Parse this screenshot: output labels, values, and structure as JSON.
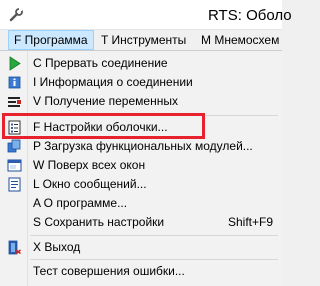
{
  "window": {
    "title": "RTS: Оболо",
    "app_icon": "wrench-icon"
  },
  "menubar": {
    "items": [
      {
        "label": "F Программа",
        "active": true
      },
      {
        "label": "T Инструменты",
        "active": false
      },
      {
        "label": "M Мнемосхем",
        "active": false
      }
    ]
  },
  "menu": {
    "items": [
      {
        "label": "C Прервать соединение",
        "icon": "play-icon"
      },
      {
        "label": "I Информация о соединении",
        "icon": "info-icon"
      },
      {
        "label": "V Получение переменных",
        "icon": "variables-icon"
      },
      {
        "label": "F Настройки оболочки...",
        "icon": "settings-sheet-icon"
      },
      {
        "label": "P Загрузка функциональных модулей...",
        "icon": "modules-icon"
      },
      {
        "label": "W Поверх всех окон",
        "icon": "window-icon"
      },
      {
        "label": "L Окно сообщений...",
        "icon": "messages-icon"
      },
      {
        "label": "A О программе...",
        "icon": ""
      },
      {
        "label": "S Сохранить настройки",
        "shortcut": "Shift+F9",
        "icon": ""
      },
      {
        "label": "X Выход",
        "icon": "exit-icon"
      },
      {
        "label": "Тест совершения ошибки...",
        "icon": ""
      }
    ]
  },
  "annotation": {
    "highlight_color": "#e8212f"
  }
}
